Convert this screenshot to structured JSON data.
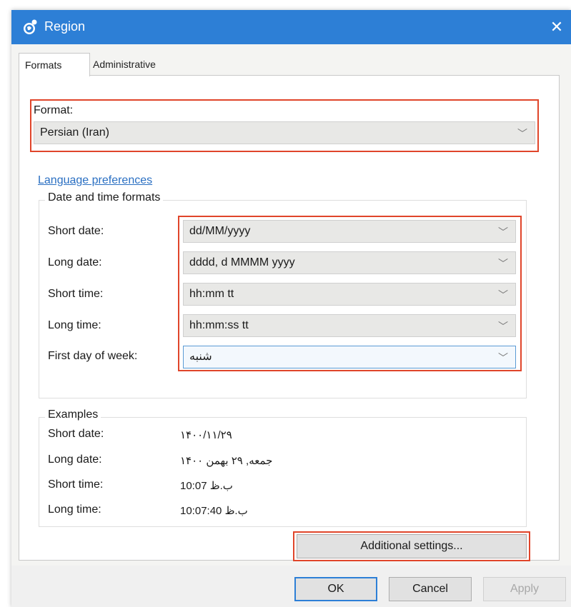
{
  "window": {
    "title": "Region",
    "close_glyph": "✕",
    "icon": "region-globe-icon"
  },
  "tabs": [
    {
      "label": "Formats",
      "active": true
    },
    {
      "label": "Administrative",
      "active": false
    }
  ],
  "format": {
    "label": "Format:",
    "value": "Persian (Iran)"
  },
  "language_link": "Language preferences",
  "date_time": {
    "title": "Date and time formats",
    "rows": [
      {
        "label": "Short date:",
        "value": "dd/MM/yyyy"
      },
      {
        "label": "Long date:",
        "value": "dddd, d MMMM yyyy"
      },
      {
        "label": "Short time:",
        "value": "hh:mm tt"
      },
      {
        "label": "Long time:",
        "value": "hh:mm:ss tt"
      },
      {
        "label": "First day of week:",
        "value": "شنبه"
      }
    ]
  },
  "examples": {
    "title": "Examples",
    "rows": [
      {
        "label": "Short date:",
        "value": "۱۴۰۰/۱۱/۲۹"
      },
      {
        "label": "Long date:",
        "value": "جمعه, ۲۹ بهمن ۱۴۰۰"
      },
      {
        "label": "Short time:",
        "value": "10:07 ب.ظ"
      },
      {
        "label": "Long time:",
        "value": "10:07:40 ب.ظ"
      }
    ]
  },
  "buttons": {
    "additional": "Additional settings...",
    "ok": "OK",
    "cancel": "Cancel",
    "apply": "Apply"
  },
  "colors": {
    "titlebar": "#2d7fd6",
    "highlight": "#e0452a",
    "link": "#2a6fc2"
  }
}
